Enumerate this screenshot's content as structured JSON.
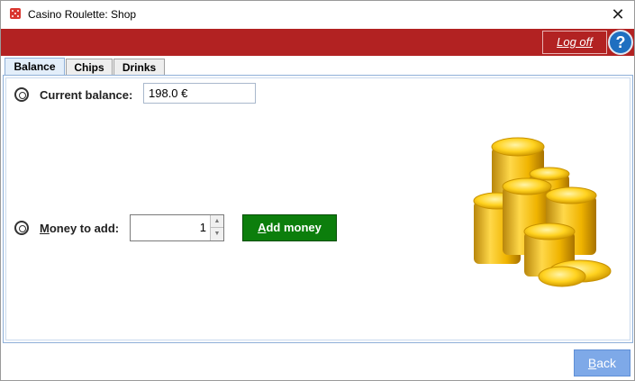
{
  "window": {
    "title": "Casino Roulette: Shop",
    "close_glyph": "✕",
    "app_icon": "roulette-app-icon"
  },
  "header": {
    "logoff_label": "Log off",
    "help_glyph": "?"
  },
  "tabs": [
    {
      "label": "Balance",
      "active": true
    },
    {
      "label": "Chips",
      "active": false
    },
    {
      "label": "Drinks",
      "active": false
    }
  ],
  "balance": {
    "label": "Current balance:",
    "value": "198.0 €",
    "icon": "chip-icon"
  },
  "money": {
    "label_prefix": "M",
    "label_rest": "oney to add:",
    "value": "1",
    "icon": "chip-icon",
    "add_prefix": "A",
    "add_rest": "dd money"
  },
  "footer": {
    "back_prefix": "B",
    "back_rest": "ack"
  },
  "colors": {
    "header": "#b22222",
    "add_button": "#0c7e0c",
    "back_button": "#7ea9e8",
    "help_button": "#1f6fc0"
  }
}
